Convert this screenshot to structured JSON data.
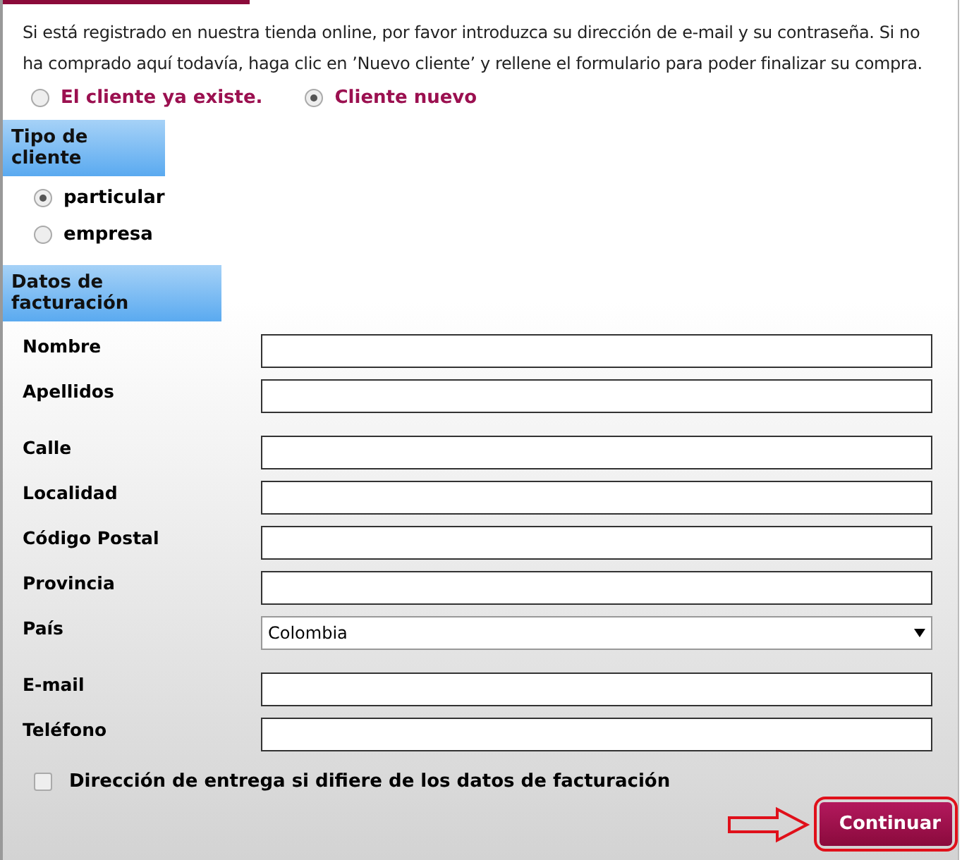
{
  "intro": "Si está registrado en nuestra tienda online, por favor introduzca su dirección de e-mail y su contraseña. Si no ha comprado aquí todavía, haga clic en ’Nuevo cliente’ y rellene el formulario para poder finalizar su compra.",
  "customer_status": [
    {
      "label": "El cliente ya existe.",
      "selected": false
    },
    {
      "label": "Cliente nuevo",
      "selected": true
    }
  ],
  "customer_type": {
    "heading": "Tipo de cliente",
    "options": [
      {
        "label": "particular",
        "selected": true
      },
      {
        "label": "empresa",
        "selected": false
      }
    ]
  },
  "billing": {
    "heading": "Datos de facturación",
    "groups": [
      [
        {
          "label": "Nombre",
          "kind": "text"
        },
        {
          "label": "Apellidos",
          "kind": "text"
        }
      ],
      [
        {
          "label": "Calle",
          "kind": "text"
        },
        {
          "label": "Localidad",
          "kind": "text"
        },
        {
          "label": "Código Postal",
          "kind": "text"
        },
        {
          "label": "Provincia",
          "kind": "text"
        },
        {
          "label": "País",
          "kind": "select",
          "value": "Colombia"
        }
      ],
      [
        {
          "label": "E-mail",
          "kind": "text"
        },
        {
          "label": "Teléfono",
          "kind": "text"
        }
      ]
    ]
  },
  "delivery_checkbox": {
    "label": "Dirección de entrega si difiere de los datos de facturación",
    "checked": false
  },
  "continue_button": "Continuar"
}
